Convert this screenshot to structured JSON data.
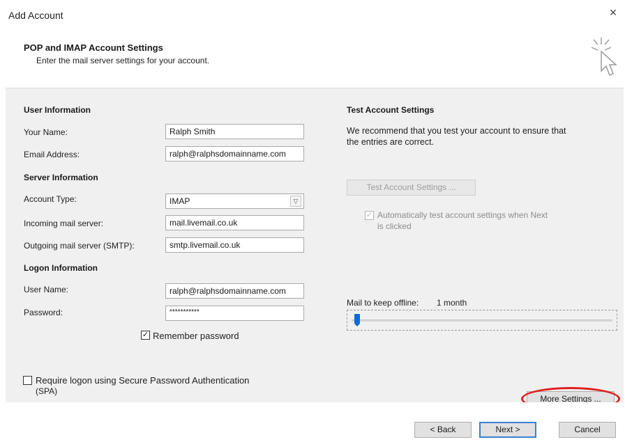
{
  "window": {
    "title": "Add Account",
    "close_glyph": "×"
  },
  "header": {
    "title": "POP and IMAP Account Settings",
    "subtitle": "Enter the mail server settings for your account.",
    "icon": "click-cursor-icon"
  },
  "user_info": {
    "heading": "User Information",
    "name_label": "Your Name:",
    "name_value": "Ralph Smith",
    "email_label": "Email Address:",
    "email_value": "ralph@ralphsdomainname.com"
  },
  "server_info": {
    "heading": "Server Information",
    "account_type_label": "Account Type:",
    "account_type_value": "IMAP",
    "incoming_label": "Incoming mail server:",
    "incoming_value": "mail.livemail.co.uk",
    "outgoing_label": "Outgoing mail server (SMTP):",
    "outgoing_value": "smtp.livemail.co.uk"
  },
  "logon_info": {
    "heading": "Logon Information",
    "username_label": "User Name:",
    "username_value": "ralph@ralphsdomainname.com",
    "password_label": "Password:",
    "password_value": "***********",
    "remember_label": "Remember password",
    "remember_checked": true,
    "spa_label_1": "Require logon using Secure Password Authentication",
    "spa_label_2": "(SPA)",
    "spa_checked": false
  },
  "test_settings": {
    "heading": "Test Account Settings",
    "desc_1": "We recommend that you test your account to ensure that",
    "desc_2": "the entries are correct.",
    "test_button": "Test Account Settings ...",
    "auto_test_1": "Automatically test account settings when Next",
    "auto_test_2": "is clicked",
    "auto_test_checked": true
  },
  "offline": {
    "label": "Mail to keep offline:",
    "value": "1 month",
    "slider_position": 0
  },
  "more_settings_button": "More Settings ...",
  "footer": {
    "back": "< Back",
    "next": "Next >",
    "cancel": "Cancel"
  },
  "colors": {
    "accent": "#0a6cd6",
    "highlight_ring": "#e02020",
    "panel": "#f0f0f0"
  }
}
